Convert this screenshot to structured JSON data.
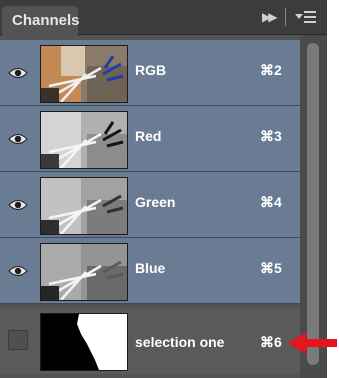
{
  "panel": {
    "tab_label": "Channels"
  },
  "channels": [
    {
      "name": "RGB",
      "shortcut": "⌘2",
      "visible": true,
      "selected": true
    },
    {
      "name": "Red",
      "shortcut": "⌘3",
      "visible": true,
      "selected": true
    },
    {
      "name": "Green",
      "shortcut": "⌘4",
      "visible": true,
      "selected": true
    },
    {
      "name": "Blue",
      "shortcut": "⌘5",
      "visible": true,
      "selected": true
    },
    {
      "name": "selection one",
      "shortcut": "⌘6",
      "visible": false,
      "selected": false
    }
  ],
  "colors": {
    "selected_row": "#6a7c93",
    "panel_bg": "#535353",
    "arrow": "#e8141b"
  }
}
